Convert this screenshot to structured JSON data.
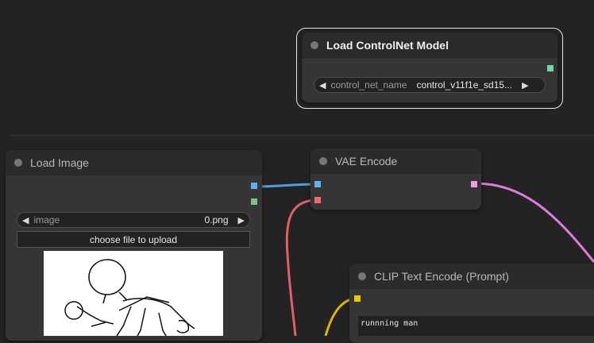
{
  "nodes": {
    "load_controlnet": {
      "title": "Load ControlNet Model",
      "widget_label": "control_net_name",
      "widget_value": "control_v11f1e_sd15..."
    },
    "load_image": {
      "title": "Load Image",
      "widget_label": "image",
      "widget_value": "0.png",
      "upload_label": "choose file to upload"
    },
    "vae_encode": {
      "title": "VAE Encode"
    },
    "clip_text_encode": {
      "title": "CLIP Text Encode (Prompt)",
      "text": "runnning man"
    }
  },
  "colors": {
    "image_port": "#62b0f0",
    "mask_port": "#7cc47a",
    "vae_port": "#f06b6b",
    "latent_port": "#f09ae8",
    "clip_port": "#f0c800",
    "controlnet_port": "#6fd6a8"
  },
  "icons": {
    "left_arrow": "◀",
    "right_arrow": "▶"
  }
}
